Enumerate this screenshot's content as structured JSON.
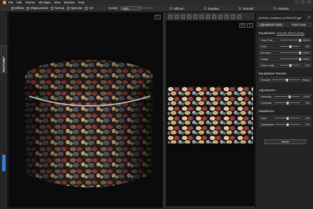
{
  "menu": {
    "items": [
      "File",
      "Edit",
      "Texture",
      "3D Maps",
      "View",
      "Window",
      "Help"
    ]
  },
  "toolbar": {
    "toggles": [
      {
        "label": "Diffuse",
        "checked": true
      },
      {
        "label": "Displacement",
        "checked": true
      },
      {
        "label": "Normal",
        "checked": true
      },
      {
        "label": "Specular",
        "checked": true
      },
      {
        "label": "AO",
        "checked": true
      }
    ],
    "quality_label": "Quality:",
    "quality_value": "High",
    "map_tabs": [
      "Diffuse*",
      "Displace",
      "Normal*",
      "Ambient"
    ]
  },
  "left_strip": {
    "tab_label": "TEXTURE*"
  },
  "view3d": {
    "corner_label": "T"
  },
  "view2d": {
    "corner_labels": [
      "Fit",
      "T"
    ]
  },
  "panel": {
    "filename": "pebbles_Imadipsor (020x1200.jpg*",
    "tabs": [
      "Adjustment Tools",
      "Paint Tools"
    ],
    "equalization": {
      "title": "Equalization:",
      "links": "Smooth Reset Sharp",
      "rows": [
        {
          "label": "Very Fine:",
          "value": "100%"
        },
        {
          "label": "Fine:",
          "value": "0%"
        },
        {
          "label": "Medium:",
          "value": "100%"
        },
        {
          "label": "Large:",
          "value": "100%"
        },
        {
          "label": "Very Large:",
          "value": "0%"
        }
      ]
    },
    "presets": {
      "title": "Equalization Presets:",
      "left_label": "Smooth",
      "right_label": "Sharp"
    },
    "adjustments": {
      "title": "Adjustments:",
      "rows": [
        {
          "label": "Intensity:",
          "value": "+10%"
        },
        {
          "label": "Contrast:",
          "value": "0%"
        }
      ]
    },
    "metalliness": {
      "title": "Metalliness:",
      "rows": [
        {
          "label": "Hue:",
          "value": "0%"
        },
        {
          "label": "Saturation:",
          "value": "0%"
        }
      ]
    },
    "invert_label": "Invert"
  },
  "colors": {
    "accent": "#e38a2a",
    "selection_blue": "#2f7fd0",
    "background": "#1e1e1e"
  }
}
